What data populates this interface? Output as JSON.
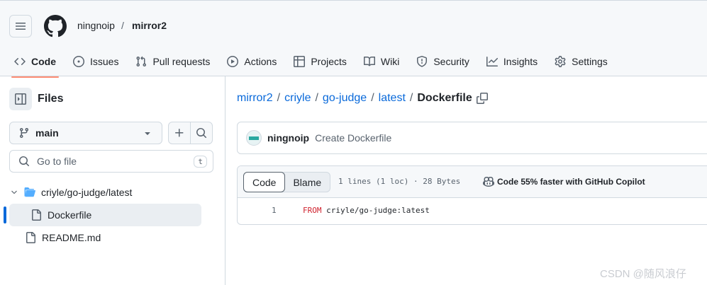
{
  "header": {
    "owner": "ningnoip",
    "slash": "/",
    "repo": "mirror2"
  },
  "nav": {
    "tabs": [
      {
        "label": "Code",
        "icon": "code-icon"
      },
      {
        "label": "Issues",
        "icon": "issue-icon"
      },
      {
        "label": "Pull requests",
        "icon": "pull-request-icon"
      },
      {
        "label": "Actions",
        "icon": "play-icon"
      },
      {
        "label": "Projects",
        "icon": "table-icon"
      },
      {
        "label": "Wiki",
        "icon": "book-icon"
      },
      {
        "label": "Security",
        "icon": "shield-icon"
      },
      {
        "label": "Insights",
        "icon": "graph-icon"
      },
      {
        "label": "Settings",
        "icon": "gear-icon"
      }
    ],
    "active": "Code"
  },
  "sidebar": {
    "title": "Files",
    "branch": "main",
    "search_placeholder": "Go to file",
    "shortcut": "t",
    "tree": {
      "folder": "criyle/go-judge/latest",
      "active_file": "Dockerfile",
      "file": "README.md"
    }
  },
  "breadcrumb": {
    "parts": [
      "mirror2",
      "criyle",
      "go-judge",
      "latest"
    ],
    "separator": "/",
    "current": "Dockerfile"
  },
  "commit": {
    "author": "ningnoip",
    "message": "Create Dockerfile"
  },
  "file": {
    "tabs": {
      "code": "Code",
      "blame": "Blame"
    },
    "meta": "1 lines (1 loc) · 28 Bytes",
    "copilot": "Code 55% faster with GitHub Copilot",
    "line_number": "1",
    "keyword": "FROM",
    "rest": " criyle/go-judge:latest"
  },
  "watermark": "CSDN @随风浪仔",
  "colors": {
    "accent_underline": "#fd8c73",
    "link": "#0969da",
    "keyword": "#cf222e"
  }
}
